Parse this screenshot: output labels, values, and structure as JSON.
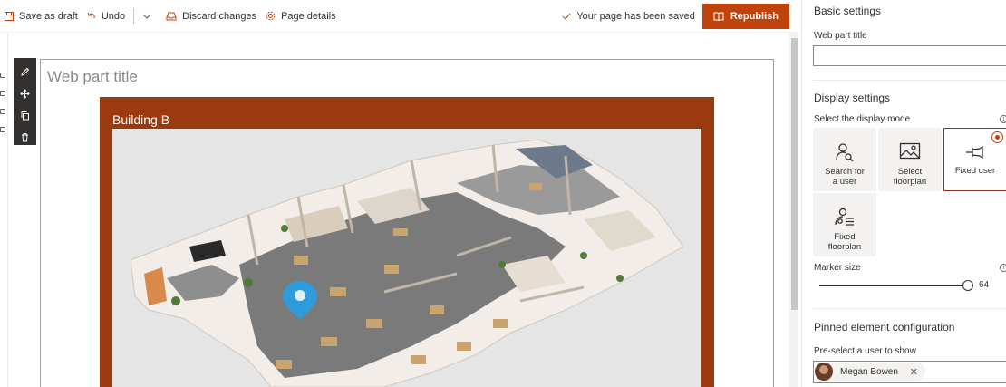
{
  "toolbar": {
    "save_draft": "Save as draft",
    "undo": "Undo",
    "discard": "Discard changes",
    "page_details": "Page details",
    "saved_status": "Your page has been saved",
    "republish": "Republish"
  },
  "webpart": {
    "title_placeholder": "Web part title",
    "building_label": "Building B"
  },
  "panel": {
    "basic_settings": "Basic settings",
    "web_part_title_label": "Web part title",
    "web_part_title_value": "",
    "display_settings": "Display settings",
    "display_mode_label": "Select the display mode",
    "modes": [
      {
        "line1": "Search for",
        "line2": "a user",
        "icon": "search-user-icon",
        "selected": false
      },
      {
        "line1": "Select",
        "line2": "floorplan",
        "icon": "image-icon",
        "selected": false
      },
      {
        "line1": "Fixed user",
        "line2": "",
        "icon": "pin-icon",
        "selected": true
      },
      {
        "line1": "Fixed",
        "line2": "floorplan",
        "icon": "fixed-floorplan-icon",
        "selected": false
      }
    ],
    "marker_size_label": "Marker size",
    "marker_size_value": "64",
    "pinned_config": "Pinned element configuration",
    "preselect_label": "Pre-select a user to show",
    "selected_user": "Megan Bowen"
  },
  "colors": {
    "accent": "#c0430d",
    "frame": "#9b3a0f",
    "selected_border": "#8a3a17"
  }
}
